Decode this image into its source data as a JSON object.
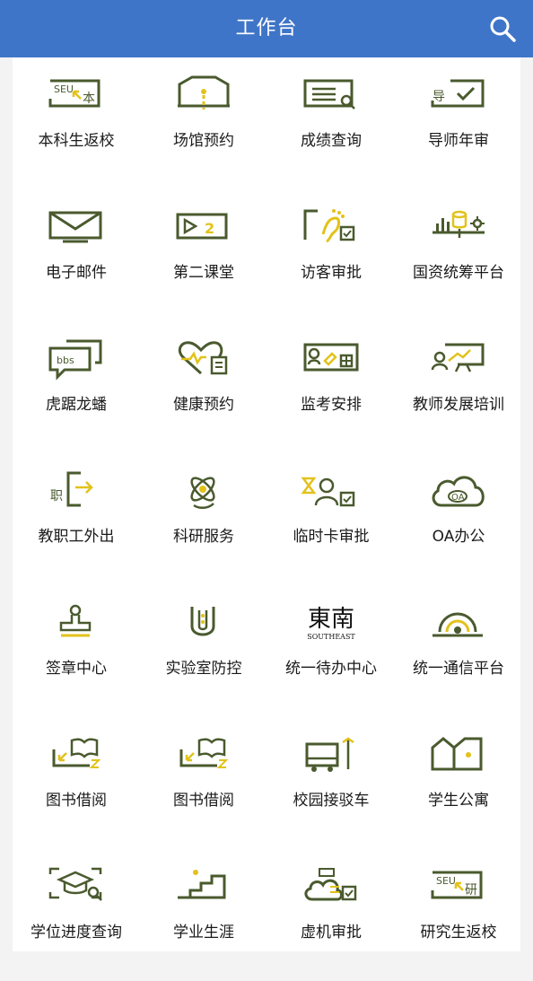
{
  "header": {
    "title": "工作台",
    "search_icon": "search-icon"
  },
  "colors": {
    "header_bg": "#3f75c8",
    "icon_green": "#4a5a2e",
    "icon_yellow": "#e2c21a"
  },
  "apps": [
    {
      "label": "本科生返校",
      "icon": "seu-return-icon"
    },
    {
      "label": "场馆预约",
      "icon": "venue-icon"
    },
    {
      "label": "成绩查询",
      "icon": "grade-search-icon"
    },
    {
      "label": "导师年审",
      "icon": "tutor-review-icon"
    },
    {
      "label": "电子邮件",
      "icon": "mail-icon"
    },
    {
      "label": "第二课堂",
      "icon": "second-class-icon"
    },
    {
      "label": "访客审批",
      "icon": "visitor-icon"
    },
    {
      "label": "国资统筹平台",
      "icon": "assets-chart-icon"
    },
    {
      "label": "虎踞龙蟠",
      "icon": "bbs-icon"
    },
    {
      "label": "健康预约",
      "icon": "health-heart-icon"
    },
    {
      "label": "监考安排",
      "icon": "invigilation-icon"
    },
    {
      "label": "教师发展培训",
      "icon": "teacher-training-icon"
    },
    {
      "label": "教职工外出",
      "icon": "staff-exit-icon"
    },
    {
      "label": "科研服务",
      "icon": "research-atom-icon"
    },
    {
      "label": "临时卡审批",
      "icon": "temp-card-icon"
    },
    {
      "label": "OA办公",
      "icon": "oa-cloud-icon"
    },
    {
      "label": "签章中心",
      "icon": "stamp-icon"
    },
    {
      "label": "实验室防控",
      "icon": "lab-tube-icon"
    },
    {
      "label": "统一待办中心",
      "icon": "southeast-logo-icon"
    },
    {
      "label": "统一通信平台",
      "icon": "signal-icon"
    },
    {
      "label": "图书借阅",
      "icon": "book-borrow-icon"
    },
    {
      "label": "图书借阅",
      "icon": "book-borrow-icon"
    },
    {
      "label": "校园接驳车",
      "icon": "shuttle-bus-icon"
    },
    {
      "label": "学生公寓",
      "icon": "apartment-icon"
    },
    {
      "label": "学位进度查询",
      "icon": "degree-search-icon"
    },
    {
      "label": "学业生涯",
      "icon": "stairs-icon"
    },
    {
      "label": "虚机审批",
      "icon": "vm-cloud-icon"
    },
    {
      "label": "研究生返校",
      "icon": "seu-grad-return-icon"
    }
  ],
  "logo_text": {
    "calligraphy": "東南",
    "english": "SOUTHEAST"
  }
}
